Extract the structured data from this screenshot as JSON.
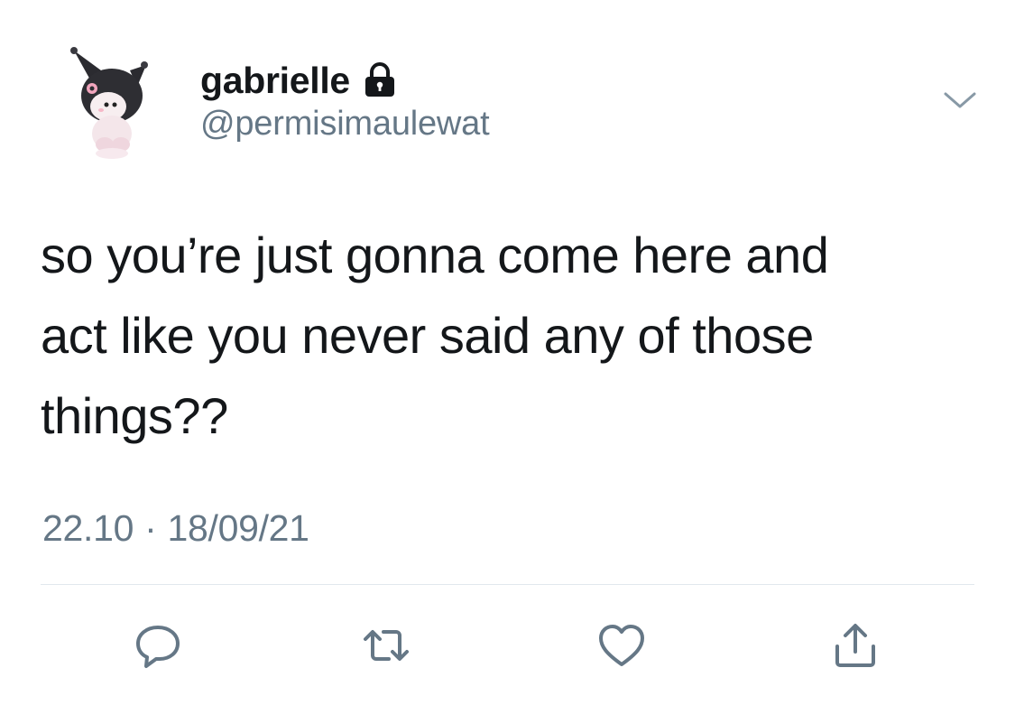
{
  "user": {
    "display_name": "gabrielle",
    "handle": "@permisimaulewat",
    "protected_icon": "lock-icon",
    "avatar": "kuromi-character-avatar"
  },
  "tweet": {
    "lines": [
      "so you’re just gonna come here and",
      "act like you never said any of those",
      "things??"
    ]
  },
  "meta": {
    "time": "22.10",
    "separator": "·",
    "date": "18/09/21"
  },
  "actions": {
    "reply": "reply-icon",
    "retweet": "retweet-icon",
    "like": "heart-icon",
    "share": "share-icon"
  },
  "colors": {
    "text": "#14171a",
    "secondary": "#657786",
    "divider": "#e1e8ed"
  }
}
